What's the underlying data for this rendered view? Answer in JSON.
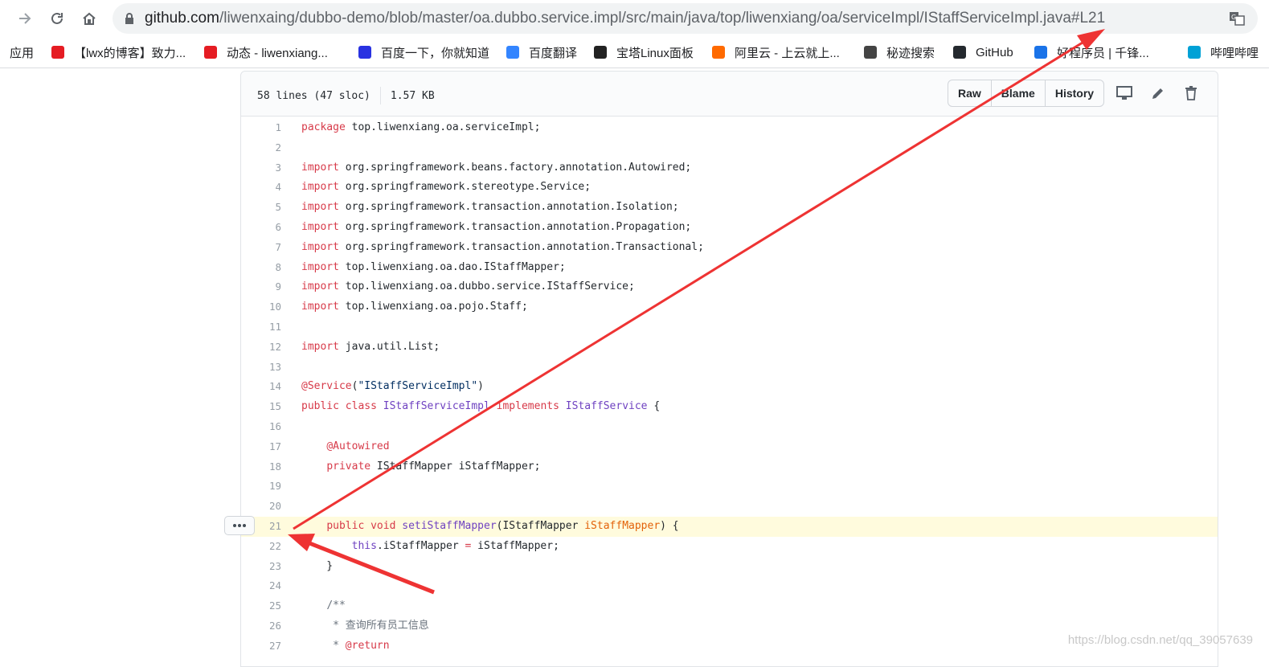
{
  "browser": {
    "url_host": "github.com",
    "url_path": "/liwenxaing/dubbo-demo/blob/master/oa.dubbo.service.impl/src/main/java/top/liwenxiang/oa/serviceImpl/IStaffServiceImpl.java#L21",
    "bookmarks": [
      {
        "label": "应用",
        "icon": "apps"
      },
      {
        "label": "【lwx的博客】致力...",
        "icon": "csdn-icon",
        "color": "#e51c23"
      },
      {
        "label": "动态 - liwenxiang...",
        "icon": "g-icon",
        "color": "#e51c23"
      },
      {
        "label": "百度一下，你就知道",
        "icon": "baidu-paw-icon",
        "color": "#2932e1"
      },
      {
        "label": "百度翻译",
        "icon": "translate-icon",
        "color": "#3385ff"
      },
      {
        "label": "宝塔Linux面板",
        "icon": "bt-icon",
        "color": "#222222"
      },
      {
        "label": "阿里云 - 上云就上...",
        "icon": "aliyun-icon",
        "color": "#ff6a00"
      },
      {
        "label": "秘迹搜索",
        "icon": "moon-icon",
        "color": "#444444"
      },
      {
        "label": "GitHub",
        "icon": "github-icon",
        "color": "#24292e"
      },
      {
        "label": "好程序员 | 千锋...",
        "icon": "q-icon",
        "color": "#1a73e8"
      },
      {
        "label": "哔哩哔哩",
        "icon": "bilibili-icon",
        "color": "#00a1d6"
      }
    ]
  },
  "file": {
    "lines_info": "58 lines (47 sloc)",
    "size": "1.57 KB",
    "buttons": [
      "Raw",
      "Blame",
      "History"
    ]
  },
  "code_lines": [
    {
      "n": "1",
      "html": "<span class='kw'>package</span> top.liwenxiang.oa.serviceImpl;"
    },
    {
      "n": "2",
      "html": ""
    },
    {
      "n": "3",
      "html": "<span class='kw'>import</span> org.springframework.beans.factory.annotation.Autowired;"
    },
    {
      "n": "4",
      "html": "<span class='kw'>import</span> org.springframework.stereotype.Service;"
    },
    {
      "n": "5",
      "html": "<span class='kw'>import</span> org.springframework.transaction.annotation.Isolation;"
    },
    {
      "n": "6",
      "html": "<span class='kw'>import</span> org.springframework.transaction.annotation.Propagation;"
    },
    {
      "n": "7",
      "html": "<span class='kw'>import</span> org.springframework.transaction.annotation.Transactional;"
    },
    {
      "n": "8",
      "html": "<span class='kw'>import</span> top.liwenxiang.oa.dao.IStaffMapper;"
    },
    {
      "n": "9",
      "html": "<span class='kw'>import</span> top.liwenxiang.oa.dubbo.service.IStaffService;"
    },
    {
      "n": "10",
      "html": "<span class='kw'>import</span> top.liwenxiang.oa.pojo.Staff;"
    },
    {
      "n": "11",
      "html": ""
    },
    {
      "n": "12",
      "html": "<span class='kw'>import</span> java.util.List;"
    },
    {
      "n": "13",
      "html": ""
    },
    {
      "n": "14",
      "html": "<span class='kw'>@Service</span>(<span class='str'>\"IStaffServiceImpl\"</span>)"
    },
    {
      "n": "15",
      "html": "<span class='kw'>public</span> <span class='kw'>class</span> <span class='cls'>IStaffServiceImpl</span> <span class='kw'>implements</span> <span class='cls'>IStaffService</span> {"
    },
    {
      "n": "16",
      "html": ""
    },
    {
      "n": "17",
      "html": "    <span class='kw'>@Autowired</span>"
    },
    {
      "n": "18",
      "html": "    <span class='kw'>private</span> IStaffMapper iStaffMapper;"
    },
    {
      "n": "19",
      "html": ""
    },
    {
      "n": "20",
      "html": ""
    },
    {
      "n": "21",
      "html": "    <span class='kw'>public</span> <span class='kw'>void</span> <span class='cls'>setiStaffMapper</span>(IStaffMapper <span class='pr'>iStaffMapper</span>) {",
      "hl": true
    },
    {
      "n": "22",
      "html": "        <span class='cls'>this</span>.iStaffMapper <span class='kw'>=</span> iStaffMapper;"
    },
    {
      "n": "23",
      "html": "    }"
    },
    {
      "n": "24",
      "html": ""
    },
    {
      "n": "25",
      "html": "    <span class='cm'>/**</span>"
    },
    {
      "n": "26",
      "html": "<span class='cm'>     * 查询所有员工信息</span>"
    },
    {
      "n": "27",
      "html": "<span class='cm'>     * </span><span class='kw'>@return</span>"
    }
  ],
  "watermark": "https://blog.csdn.net/qq_39057639"
}
